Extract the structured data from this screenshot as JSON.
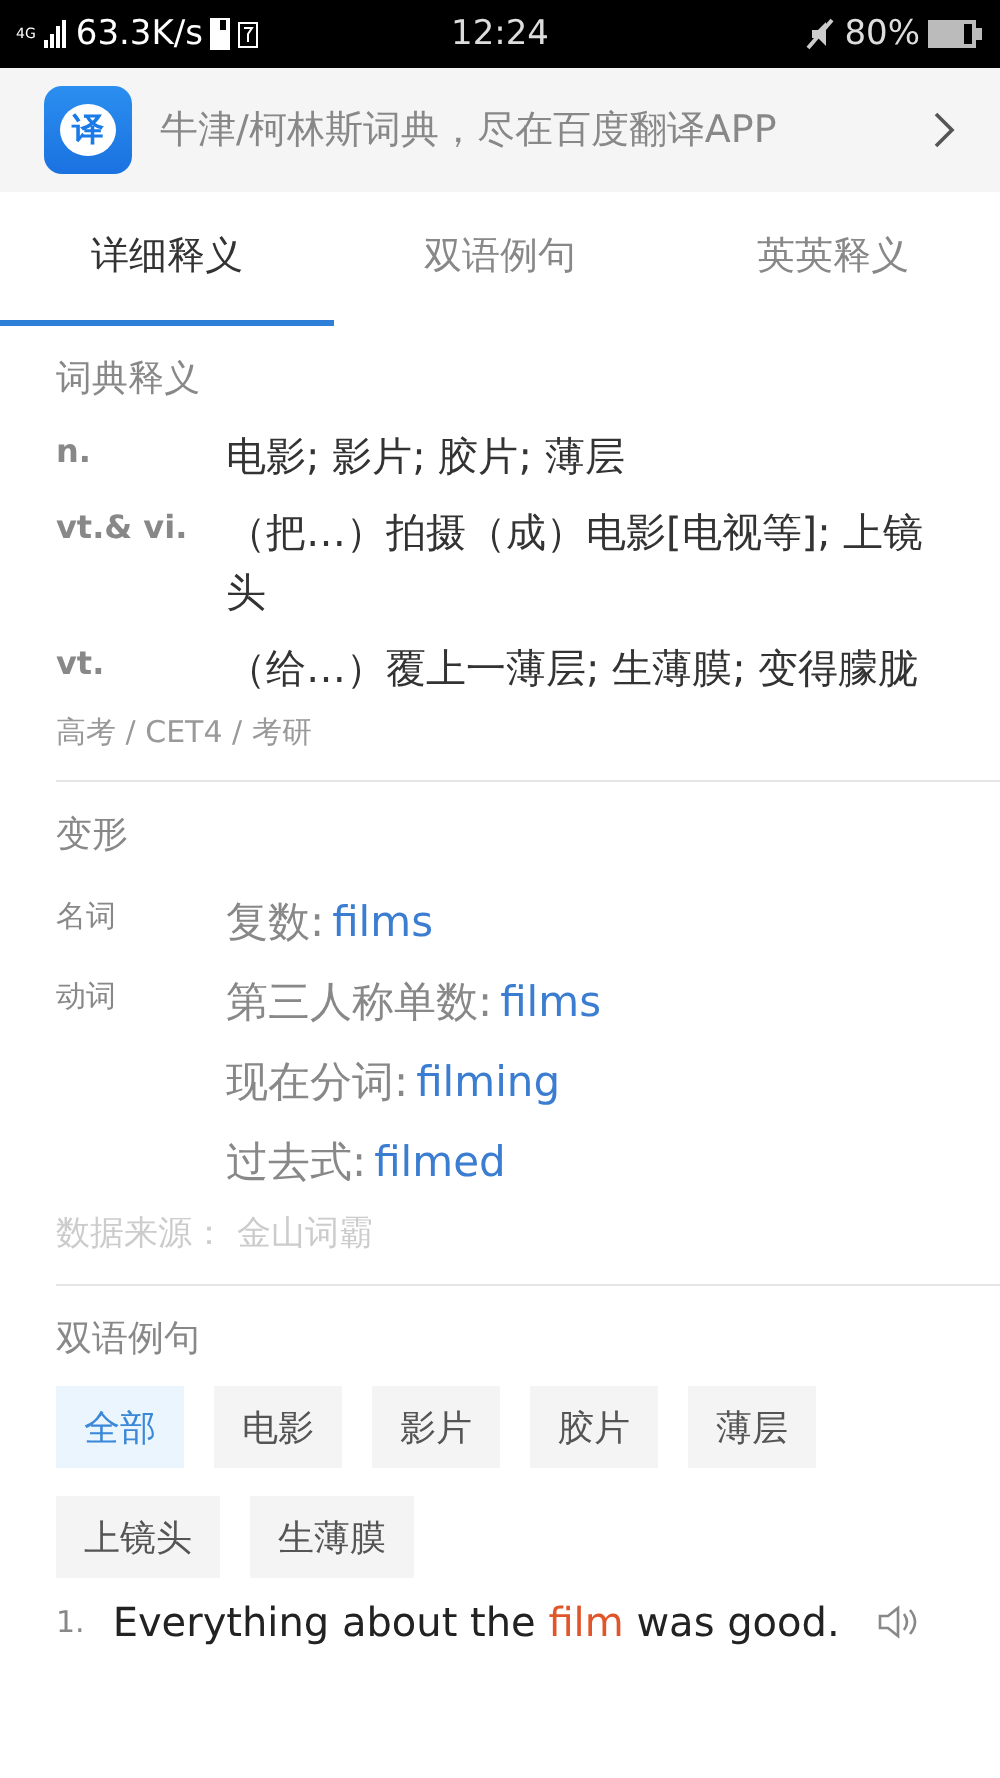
{
  "status_bar": {
    "network": "4G",
    "speed": "63.3K/s",
    "time": "12:24",
    "battery": "80%"
  },
  "banner": {
    "text": "牛津/柯林斯词典，尽在百度翻译APP",
    "icon_text": "译"
  },
  "tabs": [
    {
      "label": "详细释义",
      "selected": true
    },
    {
      "label": "双语例句",
      "selected": false
    },
    {
      "label": "英英释义",
      "selected": false
    }
  ],
  "definitions": {
    "title": "词典释义",
    "entries": [
      {
        "pos": "n.",
        "meaning": "电影; 影片; 胶片; 薄层"
      },
      {
        "pos": "vt.& vi.",
        "meaning": "（把…）拍摄（成）电影[电视等]; 上镜头"
      },
      {
        "pos": "vt.",
        "meaning": "（给…）覆上一薄层; 生薄膜; 变得朦胧"
      }
    ],
    "levels": "高考 / CET4 / 考研"
  },
  "forms": {
    "title": "变形",
    "groups": [
      {
        "pos": "名词",
        "items": [
          {
            "label": "复数:",
            "word": "films"
          }
        ]
      },
      {
        "pos": "动词",
        "items": [
          {
            "label": "第三人称单数:",
            "word": "films"
          },
          {
            "label": "现在分词:",
            "word": "filming"
          },
          {
            "label": "过去式:",
            "word": "filmed"
          }
        ]
      }
    ],
    "source": "数据来源：  金山词霸"
  },
  "examples": {
    "title": "双语例句",
    "filters": [
      {
        "label": "全部",
        "selected": true
      },
      {
        "label": "电影",
        "selected": false
      },
      {
        "label": "影片",
        "selected": false
      },
      {
        "label": "胶片",
        "selected": false
      },
      {
        "label": "薄层",
        "selected": false
      },
      {
        "label": "上镜头",
        "selected": false
      },
      {
        "label": "生薄膜",
        "selected": false
      }
    ],
    "sentences": [
      {
        "number": "1.",
        "parts": [
          {
            "text": "Everything about the ",
            "highlight": false
          },
          {
            "text": "film",
            "highlight": true
          },
          {
            "text": " was good.",
            "highlight": false
          }
        ]
      }
    ]
  }
}
